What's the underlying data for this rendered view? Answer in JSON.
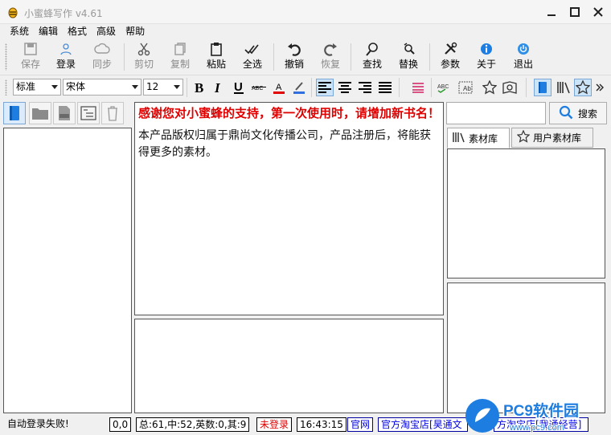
{
  "window": {
    "title": "小蜜蜂写作 v4.61",
    "controls": [
      "minimize",
      "maximize",
      "close"
    ]
  },
  "menu": [
    "系统",
    "编辑",
    "格式",
    "高级",
    "帮助"
  ],
  "toolbar": {
    "save": "保存",
    "login": "登录",
    "sync": "同步",
    "cut": "剪切",
    "copy": "复制",
    "paste": "粘贴",
    "select_all": "全选",
    "undo": "撤销",
    "redo": "恢复",
    "find": "查找",
    "replace": "替换",
    "params": "参数",
    "about": "关于",
    "exit": "退出"
  },
  "format": {
    "style": "标准",
    "font": "宋体",
    "size": "12"
  },
  "editor": {
    "notice": "感谢您对小蜜蜂的支持，第一次使用时，请增加新书名！",
    "body": "本产品版权归属于鼎尚文化传播公司，产品注册后，将能获得更多的素材。"
  },
  "search": {
    "placeholder": "",
    "button": "搜索"
  },
  "tabs": [
    "素材库",
    "用户素材库"
  ],
  "status": {
    "message": "自动登录失败!",
    "cursor": "0,0",
    "count": "总:61,中:52,英数:0,其:9",
    "login": "未登录",
    "time": "16:43:15",
    "website": "官网",
    "shop1": "官方淘宝店[昊通文",
    "shop2": "方淘宝店[我通经营]"
  },
  "watermark": {
    "brand": "PC9软件园",
    "url": "www.pc9.com"
  },
  "colors": {
    "accent": "#1e7de0",
    "warning_text": "#e00000",
    "link": "#0000e0"
  }
}
